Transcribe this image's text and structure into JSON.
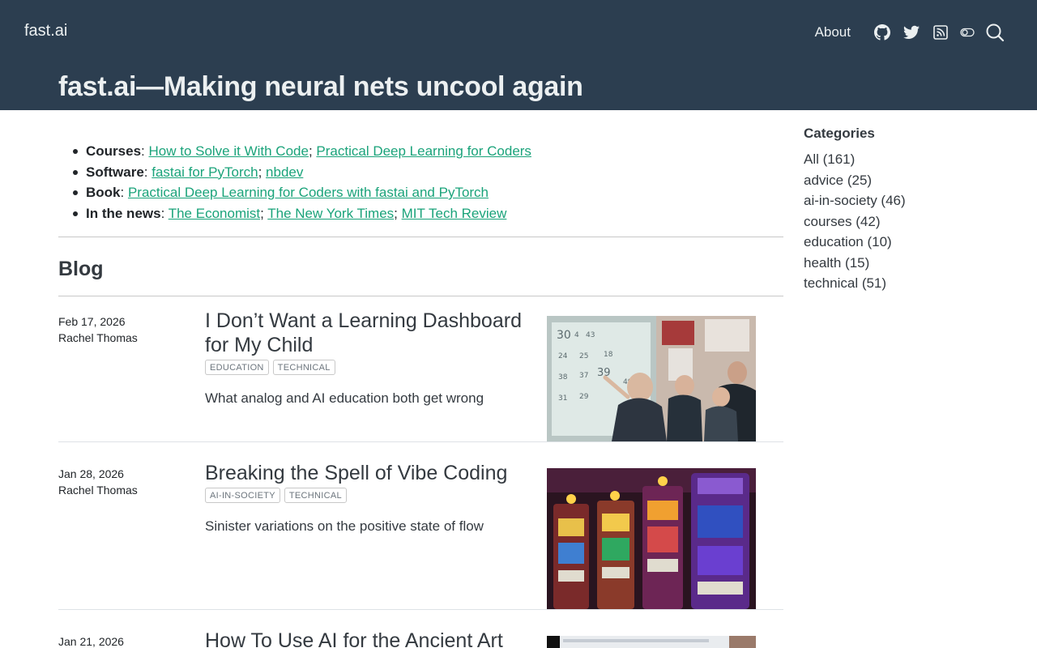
{
  "header": {
    "brand": "fast.ai",
    "nav": {
      "about": "About"
    },
    "icons": [
      "github-icon",
      "twitter-icon",
      "rss-icon",
      "toggle-icon",
      "search-icon"
    ],
    "page_title": "fast.ai—Making neural nets uncool again"
  },
  "intro": {
    "items": [
      {
        "label": "Courses",
        "links": [
          "How to Solve it With Code",
          "Practical Deep Learning for Coders"
        ]
      },
      {
        "label": "Software",
        "links": [
          "fastai for PyTorch",
          "nbdev"
        ]
      },
      {
        "label": "Book",
        "links": [
          "Practical Deep Learning for Coders with fastai and PyTorch"
        ]
      },
      {
        "label": "In the news",
        "links": [
          "The Economist",
          "The New York Times",
          "MIT Tech Review"
        ]
      }
    ]
  },
  "blog": {
    "heading": "Blog",
    "posts": [
      {
        "date": "Feb 17, 2026",
        "author": "Rachel Thomas",
        "title": "I Don’t Want a Learning Dashboard for My Child",
        "tags": [
          "education",
          "technical"
        ],
        "description": "What analog and AI education both get wrong"
      },
      {
        "date": "Jan 28, 2026",
        "author": "Rachel Thomas",
        "title": "Breaking the Spell of Vibe Coding",
        "tags": [
          "ai-in-society",
          "technical"
        ],
        "description": "Sinister variations on the positive state of flow"
      },
      {
        "date": "Jan 21, 2026",
        "author": "",
        "title": "How To Use AI for the Ancient Art",
        "tags": [],
        "description": ""
      }
    ]
  },
  "sidebar": {
    "heading": "Categories",
    "categories": [
      "All (161)",
      "advice (25)",
      "ai-in-society (46)",
      "courses (42)",
      "education (10)",
      "health (15)",
      "technical (51)"
    ]
  },
  "colors": {
    "header_bg": "#2c3e50",
    "link": "#1aa37a",
    "header_text": "#ecf0f1"
  }
}
